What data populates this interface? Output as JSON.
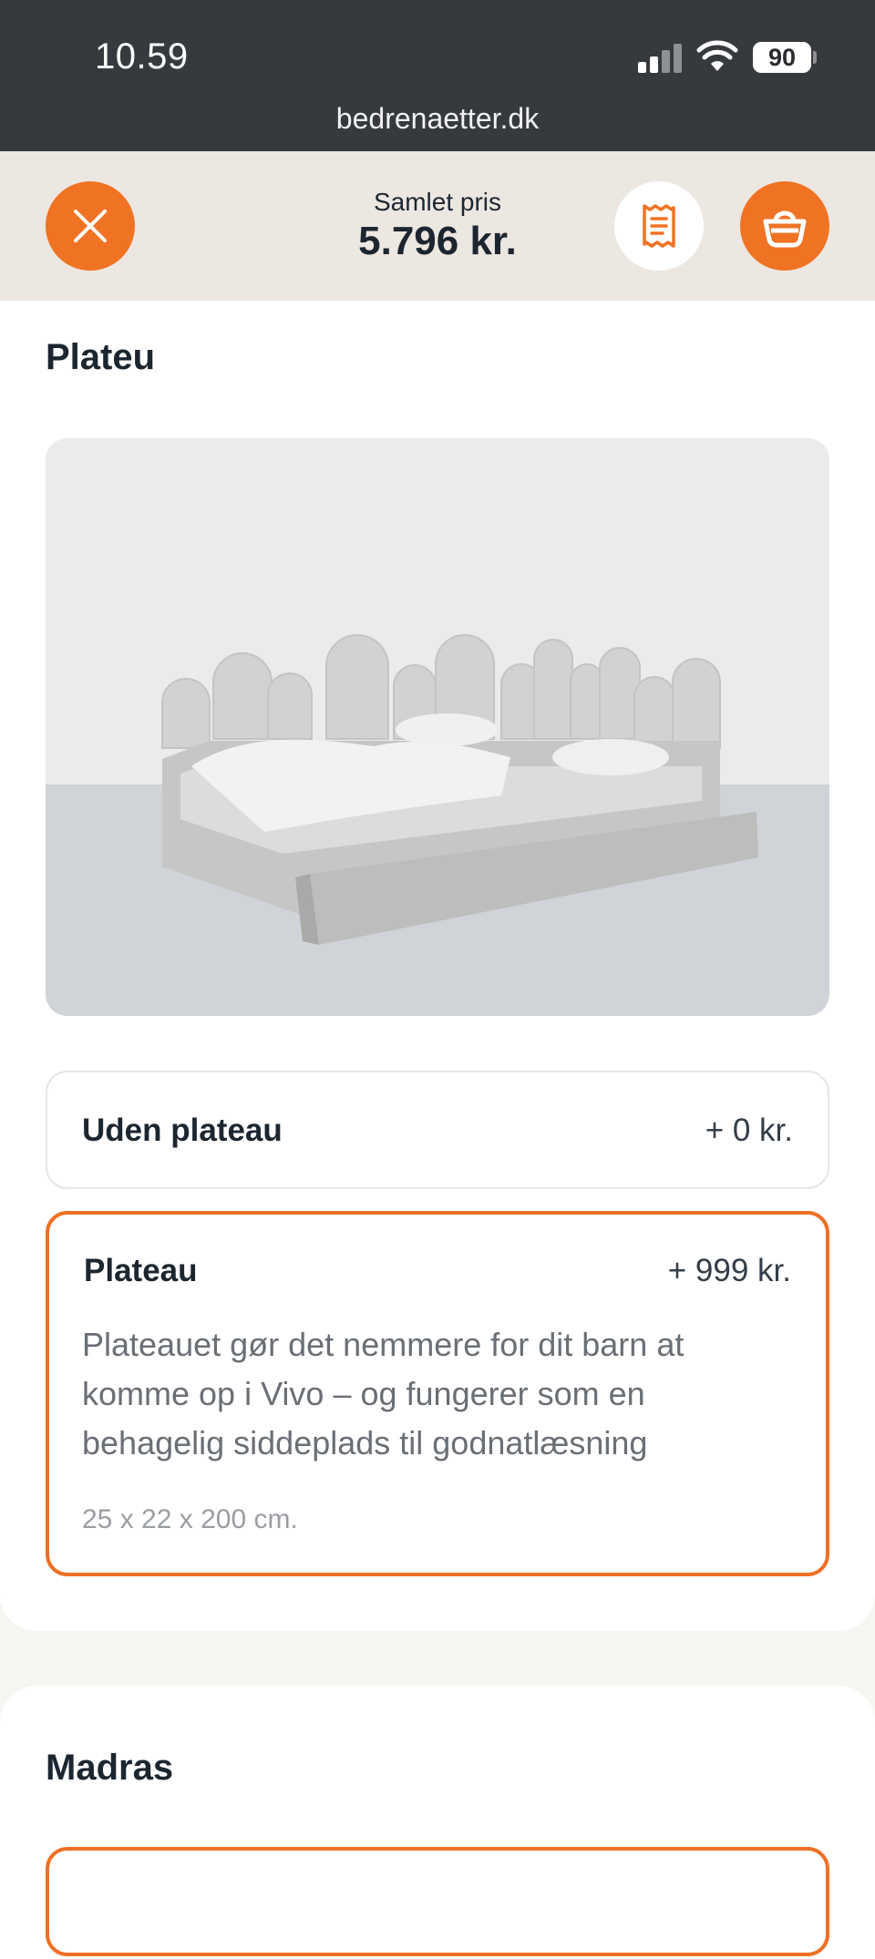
{
  "status_bar": {
    "time": "10.59",
    "url": "bedrenaetter.dk",
    "battery": "90"
  },
  "header": {
    "price_label": "Samlet pris",
    "price_value": "5.796 kr.",
    "close_icon": "close-icon",
    "receipt_icon": "receipt-icon",
    "basket_icon": "basket-icon"
  },
  "colors": {
    "accent": "#f07324",
    "header_bg": "#ede7e1",
    "status_bg": "#36393d"
  },
  "plateau_section": {
    "title": "Plateu",
    "options": [
      {
        "title": "Uden plateau",
        "price": "+ 0 kr.",
        "selected": false
      },
      {
        "title": "Plateau",
        "price": "+ 999 kr.",
        "description": "Plateauet gør det nemmere for dit barn at komme op i Vivo – og fungerer som en behagelig siddeplads til godnatlæsning",
        "dimensions": "25 x 22 x 200 cm.",
        "selected": true
      }
    ]
  },
  "mattress_section": {
    "title": "Madras"
  }
}
